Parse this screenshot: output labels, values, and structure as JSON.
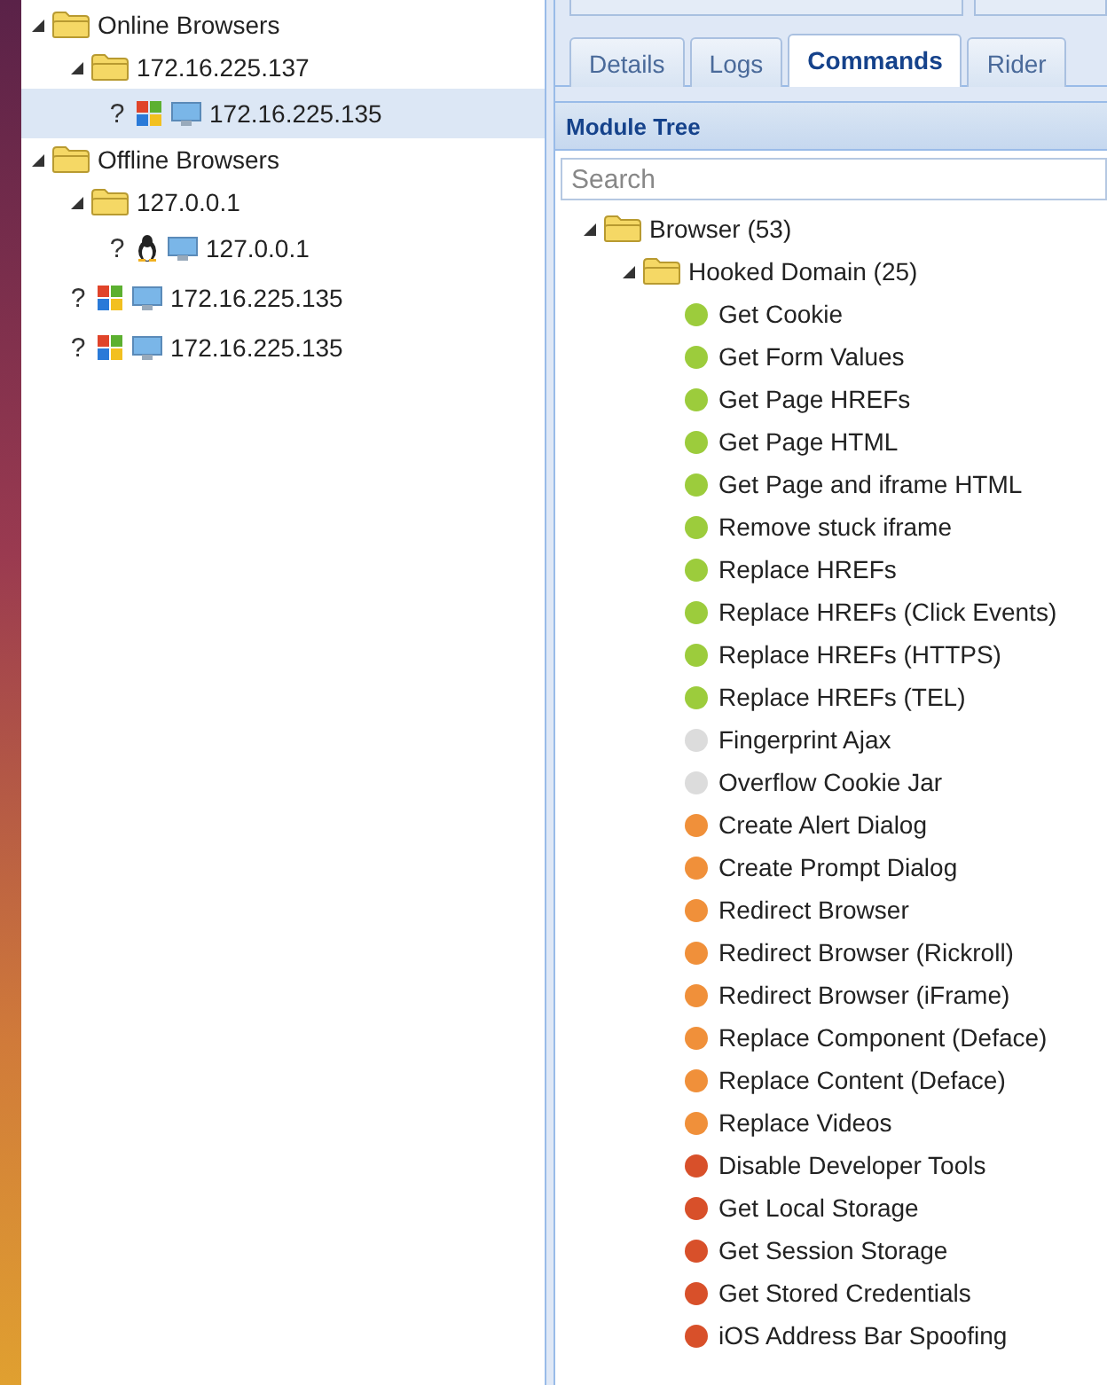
{
  "browsers_tree": [
    {
      "kind": "folder",
      "label": "Online Browsers",
      "expanded": true,
      "children": [
        {
          "kind": "folder",
          "label": "172.16.225.137",
          "expanded": true,
          "children": [
            {
              "kind": "windows",
              "mark": "?",
              "label": "172.16.225.135",
              "selected": true
            }
          ]
        }
      ]
    },
    {
      "kind": "folder",
      "label": "Offline Browsers",
      "expanded": true,
      "children": [
        {
          "kind": "folder",
          "label": "127.0.0.1",
          "expanded": true,
          "children": [
            {
              "kind": "linux",
              "mark": "?",
              "label": "127.0.0.1",
              "selected": false
            }
          ]
        },
        {
          "kind": "windows",
          "mark": "?",
          "label": "172.16.225.135",
          "selected": false
        },
        {
          "kind": "windows",
          "mark": "?",
          "label": "172.16.225.135",
          "selected": false
        }
      ]
    }
  ],
  "tabs": [
    {
      "label": "Details",
      "selected": false
    },
    {
      "label": "Logs",
      "selected": false
    },
    {
      "label": "Commands",
      "selected": true
    },
    {
      "label": "Rider",
      "selected": false
    }
  ],
  "module_tree": {
    "title": "Module Tree",
    "search": {
      "placeholder": "Search"
    },
    "items": [
      {
        "kind": "folder",
        "label": "Browser (53)",
        "expanded": true,
        "children": [
          {
            "kind": "folder",
            "label": "Hooked Domain (25)",
            "expanded": true,
            "children": [
              {
                "kind": "module",
                "label": "Get Cookie",
                "color": "#9ccc3c"
              },
              {
                "kind": "module",
                "label": "Get Form Values",
                "color": "#9ccc3c"
              },
              {
                "kind": "module",
                "label": "Get Page HREFs",
                "color": "#9ccc3c"
              },
              {
                "kind": "module",
                "label": "Get Page HTML",
                "color": "#9ccc3c"
              },
              {
                "kind": "module",
                "label": "Get Page and iframe HTML",
                "color": "#9ccc3c"
              },
              {
                "kind": "module",
                "label": "Remove stuck iframe",
                "color": "#9ccc3c"
              },
              {
                "kind": "module",
                "label": "Replace HREFs",
                "color": "#9ccc3c"
              },
              {
                "kind": "module",
                "label": "Replace HREFs (Click Events)",
                "color": "#9ccc3c"
              },
              {
                "kind": "module",
                "label": "Replace HREFs (HTTPS)",
                "color": "#9ccc3c"
              },
              {
                "kind": "module",
                "label": "Replace HREFs (TEL)",
                "color": "#9ccc3c"
              },
              {
                "kind": "module",
                "label": "Fingerprint Ajax",
                "color": "#dcdcdc"
              },
              {
                "kind": "module",
                "label": "Overflow Cookie Jar",
                "color": "#dcdcdc"
              },
              {
                "kind": "module",
                "label": "Create Alert Dialog",
                "color": "#f0903a"
              },
              {
                "kind": "module",
                "label": "Create Prompt Dialog",
                "color": "#f0903a"
              },
              {
                "kind": "module",
                "label": "Redirect Browser",
                "color": "#f0903a"
              },
              {
                "kind": "module",
                "label": "Redirect Browser (Rickroll)",
                "color": "#f0903a"
              },
              {
                "kind": "module",
                "label": "Redirect Browser (iFrame)",
                "color": "#f0903a"
              },
              {
                "kind": "module",
                "label": "Replace Component (Deface)",
                "color": "#f0903a"
              },
              {
                "kind": "module",
                "label": "Replace Content (Deface)",
                "color": "#f0903a"
              },
              {
                "kind": "module",
                "label": "Replace Videos",
                "color": "#f0903a"
              },
              {
                "kind": "module",
                "label": "Disable Developer Tools",
                "color": "#d8502a"
              },
              {
                "kind": "module",
                "label": "Get Local Storage",
                "color": "#d8502a"
              },
              {
                "kind": "module",
                "label": "Get Session Storage",
                "color": "#d8502a"
              },
              {
                "kind": "module",
                "label": "Get Stored Credentials",
                "color": "#d8502a"
              },
              {
                "kind": "module",
                "label": "iOS Address Bar Spoofing",
                "color": "#d8502a"
              }
            ]
          }
        ]
      }
    ]
  }
}
